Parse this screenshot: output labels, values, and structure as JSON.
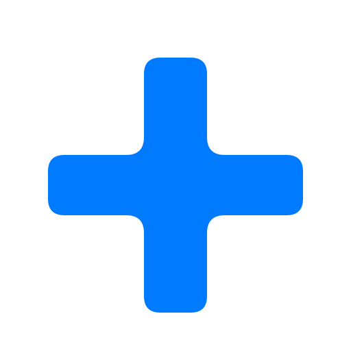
{
  "icon": {
    "name": "plus-icon",
    "color": "#007AFF",
    "background": "#FFFFFF"
  }
}
